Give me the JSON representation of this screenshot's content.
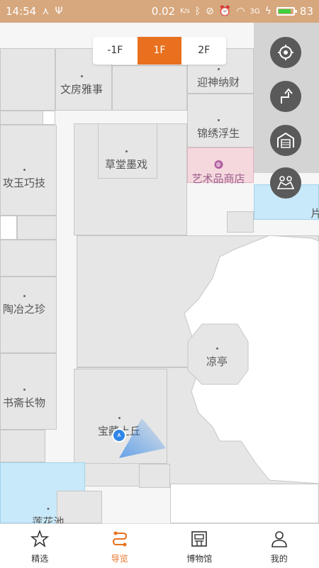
{
  "status_bar": {
    "time": "14:54",
    "network_speed": "0.02",
    "speed_unit": "K/s",
    "signal": "3G",
    "battery": "83",
    "battery_level_pct": 83
  },
  "floor_selector": {
    "floors": [
      "-1F",
      "1F",
      "2F"
    ],
    "selected": "1F"
  },
  "map_labels": {
    "wenfang": "文房雅事",
    "yingshen": "迎神纳财",
    "caotang": "草堂墨戏",
    "jinxiu": "锦绣浮生",
    "shop": "艺术品商店",
    "gongyu": "攻玉巧技",
    "taoye": "陶冶之珍",
    "liangting": "凉亭",
    "shuzhai": "书斋长物",
    "baozang": "宝藏土丘",
    "lianhua": "莲花池",
    "edge": "片"
  },
  "tools": {
    "locate": "locate-icon",
    "route": "route-icon",
    "gate": "gate-icon",
    "service": "service-icon"
  },
  "bottom_nav": {
    "items": [
      {
        "label": "精选",
        "icon": "star-icon"
      },
      {
        "label": "导览",
        "icon": "route-nav-icon"
      },
      {
        "label": "博物馆",
        "icon": "museum-icon"
      },
      {
        "label": "我的",
        "icon": "person-icon"
      }
    ],
    "active": "导览"
  },
  "colors": {
    "accent": "#e8701e",
    "status_bar": "#d7a77d",
    "shop_pink": "#f5d7de",
    "water": "#c8e9f9",
    "location_blue": "#2f86e8"
  }
}
